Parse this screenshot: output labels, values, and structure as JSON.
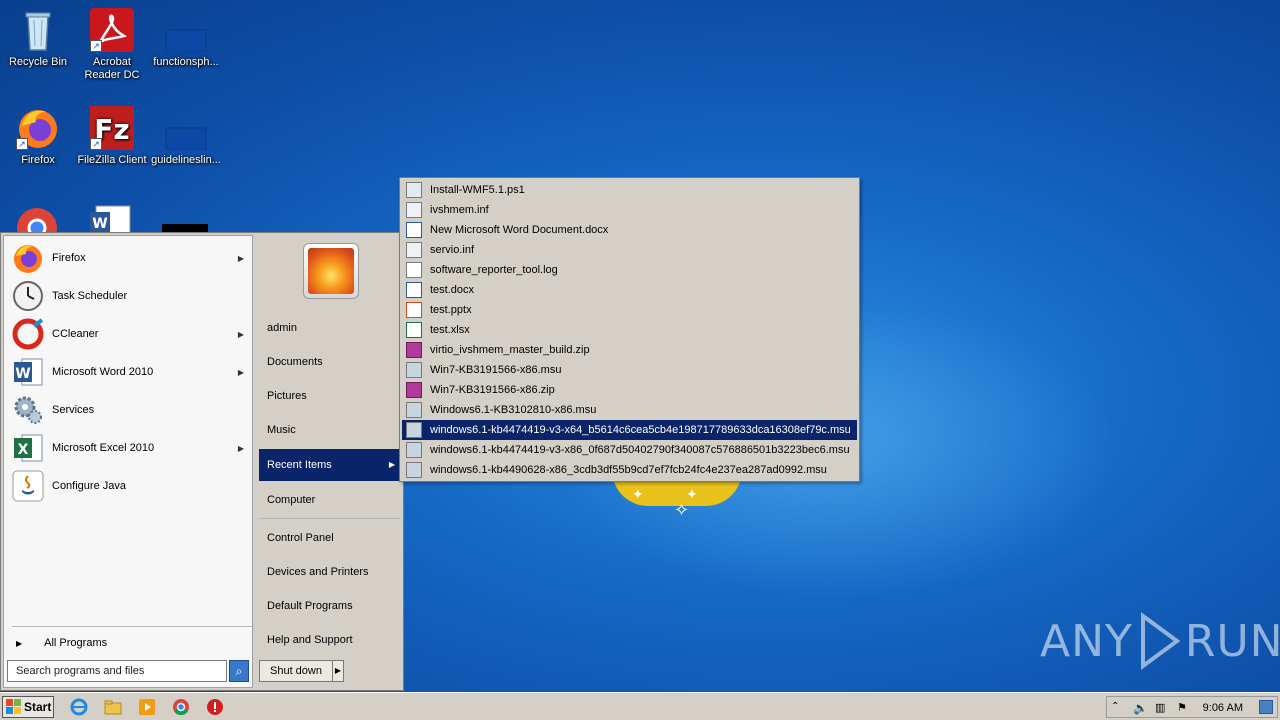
{
  "desktop": {
    "icons": [
      {
        "label": "Recycle Bin",
        "icon": "recycle-bin-icon"
      },
      {
        "label": "Acrobat Reader DC",
        "icon": "acrobat-icon"
      },
      {
        "label": "functionsph...",
        "icon": "file-icon"
      },
      {
        "label": "Firefox",
        "icon": "firefox-icon"
      },
      {
        "label": "FileZilla Client",
        "icon": "filezilla-icon"
      },
      {
        "label": "guidelineslin...",
        "icon": "file-icon"
      }
    ]
  },
  "start_menu": {
    "programs": [
      {
        "label": "Firefox",
        "has_submenu": true
      },
      {
        "label": "Task Scheduler",
        "has_submenu": false
      },
      {
        "label": "CCleaner",
        "has_submenu": true
      },
      {
        "label": "Microsoft Word 2010",
        "has_submenu": true
      },
      {
        "label": "Services",
        "has_submenu": false
      },
      {
        "label": "Microsoft Excel 2010",
        "has_submenu": true
      },
      {
        "label": "Configure Java",
        "has_submenu": false
      }
    ],
    "all_programs": "All Programs",
    "search_placeholder": "Search programs and files",
    "right_items": {
      "admin": "admin",
      "documents": "Documents",
      "pictures": "Pictures",
      "music": "Music",
      "recent_items": "Recent Items",
      "computer": "Computer",
      "control_panel": "Control Panel",
      "devices_printers": "Devices and Printers",
      "default_programs": "Default Programs",
      "help_support": "Help and Support"
    },
    "shutdown": "Shut down"
  },
  "recent_items": [
    {
      "name": "Install-WMF5.1.ps1",
      "type": "script"
    },
    {
      "name": "ivshmem.inf",
      "type": "inf"
    },
    {
      "name": "New Microsoft Word Document.docx",
      "type": "word"
    },
    {
      "name": "servio.inf",
      "type": "inf"
    },
    {
      "name": "software_reporter_tool.log",
      "type": "text"
    },
    {
      "name": "test.docx",
      "type": "word"
    },
    {
      "name": "test.pptx",
      "type": "powerpoint"
    },
    {
      "name": "test.xlsx",
      "type": "excel"
    },
    {
      "name": "virtio_ivshmem_master_build.zip",
      "type": "archive"
    },
    {
      "name": "Win7-KB3191566-x86.msu",
      "type": "msu"
    },
    {
      "name": "Win7-KB3191566-x86.zip",
      "type": "archive"
    },
    {
      "name": "Windows6.1-KB3102810-x86.msu",
      "type": "msu"
    },
    {
      "name": "windows6.1-kb4474419-v3-x64_b5614c6cea5cb4e198717789633dca16308ef79c.msu",
      "type": "msu",
      "selected": true
    },
    {
      "name": "windows6.1-kb4474419-v3-x86_0f687d50402790f340087c576886501b3223bec6.msu",
      "type": "msu"
    },
    {
      "name": "windows6.1-kb4490628-x86_3cdb3df55b9cd7ef7fcb24fc4e237ea287ad0992.msu",
      "type": "msu"
    }
  ],
  "taskbar": {
    "start_label": "Start",
    "clock": "9:06 AM"
  },
  "watermark": {
    "left": "ANY",
    "right": "RUN"
  }
}
